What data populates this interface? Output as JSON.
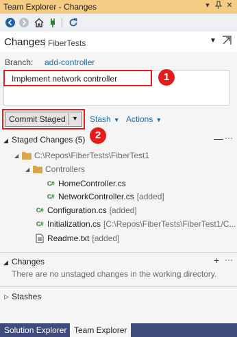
{
  "window": {
    "title": "Team Explorer - Changes",
    "controls": [
      "dropdown-icon",
      "pin-icon",
      "close-icon"
    ]
  },
  "toolbar": {
    "buttons": [
      "back-icon",
      "forward-icon",
      "home-icon",
      "connect-icon",
      "refresh-icon"
    ]
  },
  "header": {
    "page_title": "Changes",
    "repo": "FiberTests",
    "dropdown_icon": "chevron-down-icon",
    "undock_icon": "undock-icon"
  },
  "branch": {
    "label": "Branch:",
    "value": "add-controller"
  },
  "commit": {
    "message": "Implement network controller",
    "button_label": "Commit Staged",
    "stash_label": "Stash",
    "actions_label": "Actions"
  },
  "callouts": [
    "1",
    "2"
  ],
  "staged": {
    "title": "Staged Changes (5)",
    "root": "C:\\Repos\\FiberTests\\FiberTest1",
    "folder": "Controllers",
    "files": [
      {
        "name": "HomeController.cs",
        "note": ""
      },
      {
        "name": "NetworkController.cs",
        "note": "[added]"
      },
      {
        "name": "Configuration.cs",
        "note": "[added]"
      },
      {
        "name": "Initialization.cs",
        "note": "[C:\\Repos\\FiberTests\\FiberTest1/C..."
      },
      {
        "name": "Readme.txt",
        "note": "[added]"
      }
    ],
    "cs_glyph": "C#"
  },
  "changes": {
    "title": "Changes",
    "empty_text": "There are no unstaged changes in the working directory."
  },
  "stashes": {
    "title": "Stashes"
  },
  "tabs": [
    "Solution Explorer",
    "Team Explorer"
  ],
  "colors": {
    "title_bar": "#f5cc84",
    "accent_link": "#1a6fb5",
    "callout_red": "#e41c1c",
    "tab_bar": "#3f4b7a"
  }
}
